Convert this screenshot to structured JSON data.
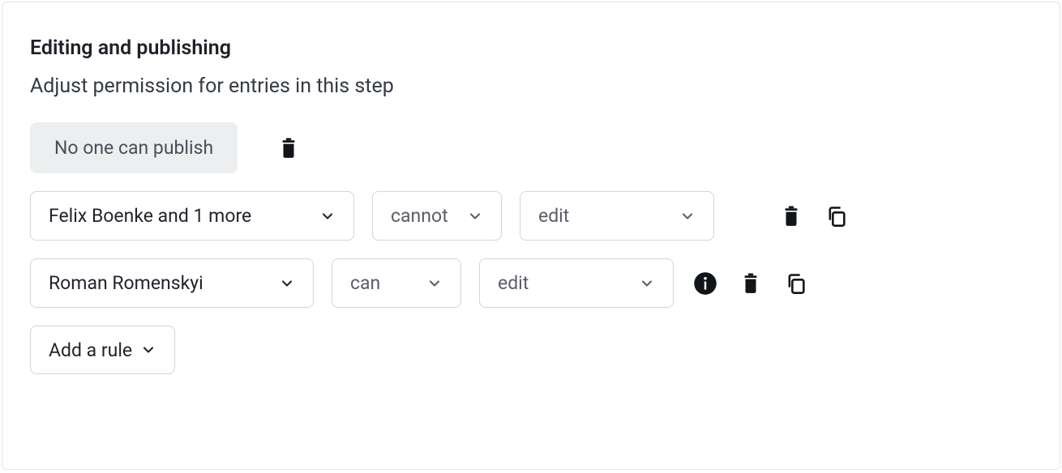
{
  "section": {
    "title": "Editing and publishing",
    "subtitle": "Adjust permission for entries in this step"
  },
  "defaultRule": {
    "label": "No one can publish"
  },
  "rules": [
    {
      "who": "Felix Boenke and 1 more",
      "modal": "cannot",
      "action": "edit",
      "hasInfo": false
    },
    {
      "who": "Roman Romenskyi",
      "modal": "can",
      "action": "edit",
      "hasInfo": true
    }
  ],
  "actions": {
    "addRule": "Add a rule"
  },
  "icons": {
    "chevron": "chevron-down",
    "trash": "trash",
    "copy": "copy",
    "info": "info"
  }
}
